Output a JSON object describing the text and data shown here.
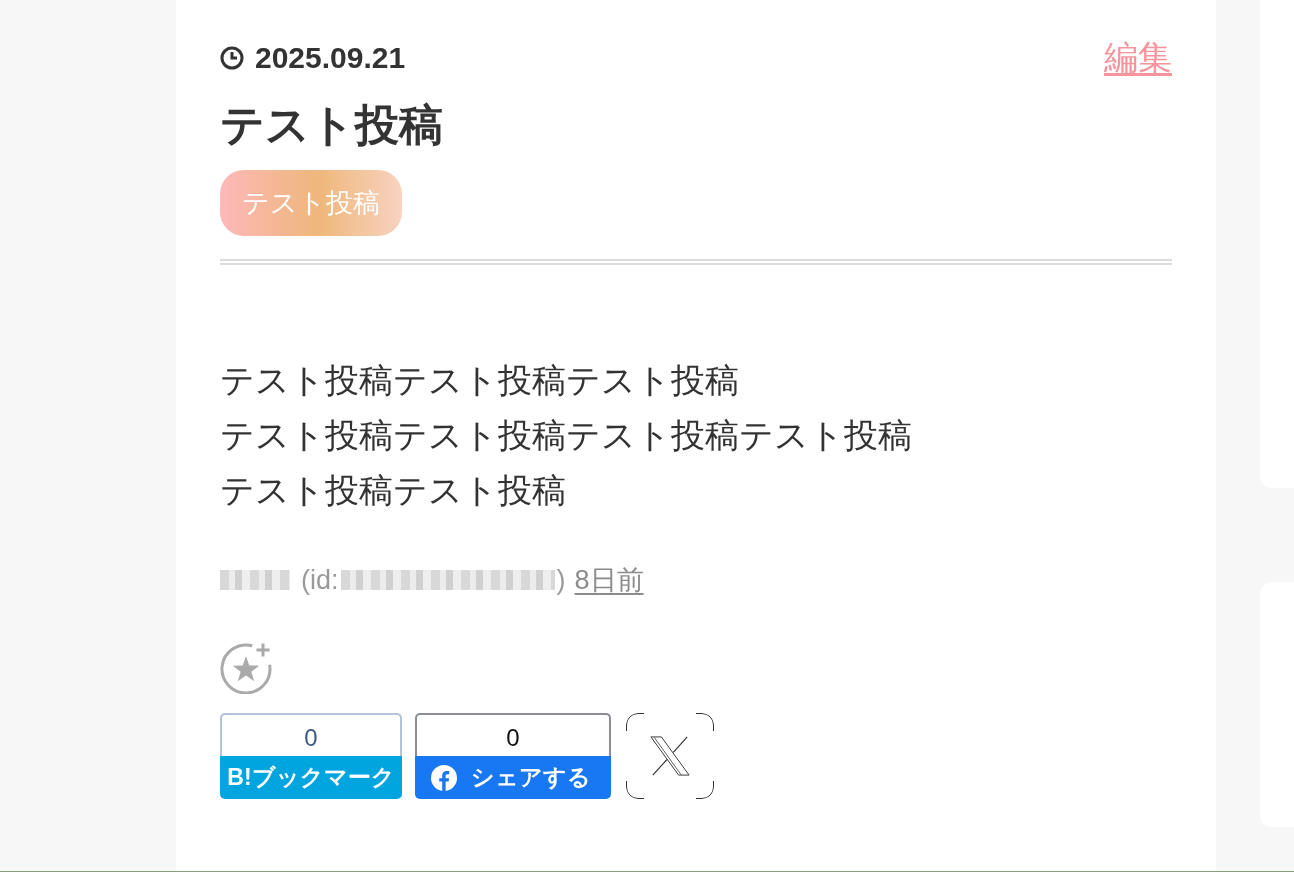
{
  "entry": {
    "date": "2025.09.21",
    "edit_link": "編集",
    "title": "テスト投稿",
    "tags": [
      {
        "label": "テスト投稿"
      }
    ],
    "body_lines": [
      "テスト投稿テスト投稿テスト投稿",
      "テスト投稿テスト投稿テスト投稿テスト投稿",
      "テスト投稿テスト投稿"
    ],
    "author": {
      "id_open": "(id:",
      "id_close": ")",
      "posted_ago": "8日前"
    },
    "share_buttons": [
      {
        "kind": "hatena",
        "count": "0",
        "label": "B!ブックマーク"
      },
      {
        "kind": "facebook",
        "count": "0",
        "label": "シェアする"
      },
      {
        "kind": "x"
      }
    ]
  }
}
